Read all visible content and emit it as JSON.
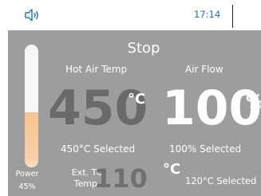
{
  "status_bar": {
    "time": "17:14",
    "sound_icon": "speaker-icon"
  },
  "panel": {
    "status": "Stop",
    "power": {
      "label": "Power",
      "value": "45%",
      "fraction": 0.45
    },
    "hot_air_temp": {
      "label": "Hot Air Temp",
      "value": "450",
      "unit": "°C",
      "selected": "450°C Selected"
    },
    "air_flow": {
      "label": "Air Flow",
      "value": "100",
      "unit": "%",
      "selected": "100% Selected"
    },
    "ext_tc": {
      "label_line1": "Ext. TC",
      "label_line2": "Temp.",
      "value": "110",
      "unit": "°C",
      "selected": "120°C Selected"
    }
  }
}
